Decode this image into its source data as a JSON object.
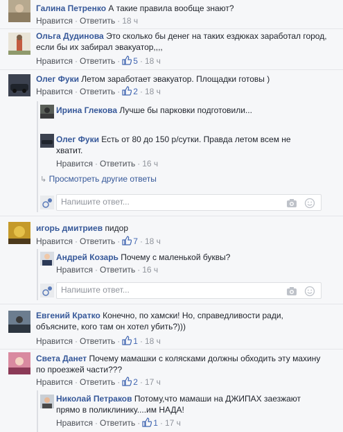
{
  "actions": {
    "like": "Нравится",
    "reply": "Ответить",
    "view_more": "Просмотреть другие ответы",
    "reply_placeholder": "Напишите ответ..."
  },
  "comments": [
    {
      "name": "Галина Петренко",
      "text": "А такие правила вообще знают?",
      "time": "18 ч"
    },
    {
      "name": "Ольга Дудинова",
      "text": "Это сколько бы денег на таких ездюках заработал город, если бы их забирал эвакуатор,,,,",
      "likes": "5",
      "time": "18 ч"
    },
    {
      "name": "Олег Фуки",
      "text": "Летом заработает эвакуатор. Площадки готовы )",
      "likes": "2",
      "time": "18 ч",
      "replies": [
        {
          "name": "Ирина Глекова",
          "text": "Лучше бы парковки подготовили..."
        },
        {
          "name": "Олег Фуки",
          "text": "Есть от 80 до 150 р/сутки. Правда летом всем не хватит.",
          "time": "16 ч"
        }
      ]
    },
    {
      "name": "игорь дмитриев",
      "text": "пидор",
      "likes": "7",
      "time": "18 ч",
      "replies": [
        {
          "name": "Андрей Козарь",
          "text": "Почему с маленькой буквы?",
          "time": "16 ч"
        }
      ]
    },
    {
      "name": "Евгений Кратко",
      "text": "Конечно, по хамски! Но, справедливости ради, объясните, кого там он хотел убить?)))",
      "likes": "1",
      "time": "18 ч"
    },
    {
      "name": "Света Данет",
      "text": "Почему мамашки с колясками должны обходить эту махину по проезжей части???",
      "likes": "2",
      "time": "17 ч",
      "replies": [
        {
          "name": "Николай Петраков",
          "text": "Потому,что мамаши на ДЖИПАХ заезжают прямо в поликлинику....им НАДА!",
          "likes": "1",
          "time": "17 ч"
        }
      ]
    }
  ],
  "colors": {
    "link_blue": "#365899",
    "like_blue": "#4267b2",
    "meta_gray": "#90949c",
    "background": "#f6f7f9"
  },
  "icons": [
    "like-icon",
    "camera-icon",
    "emoji-icon",
    "reply-arrow-icon"
  ]
}
